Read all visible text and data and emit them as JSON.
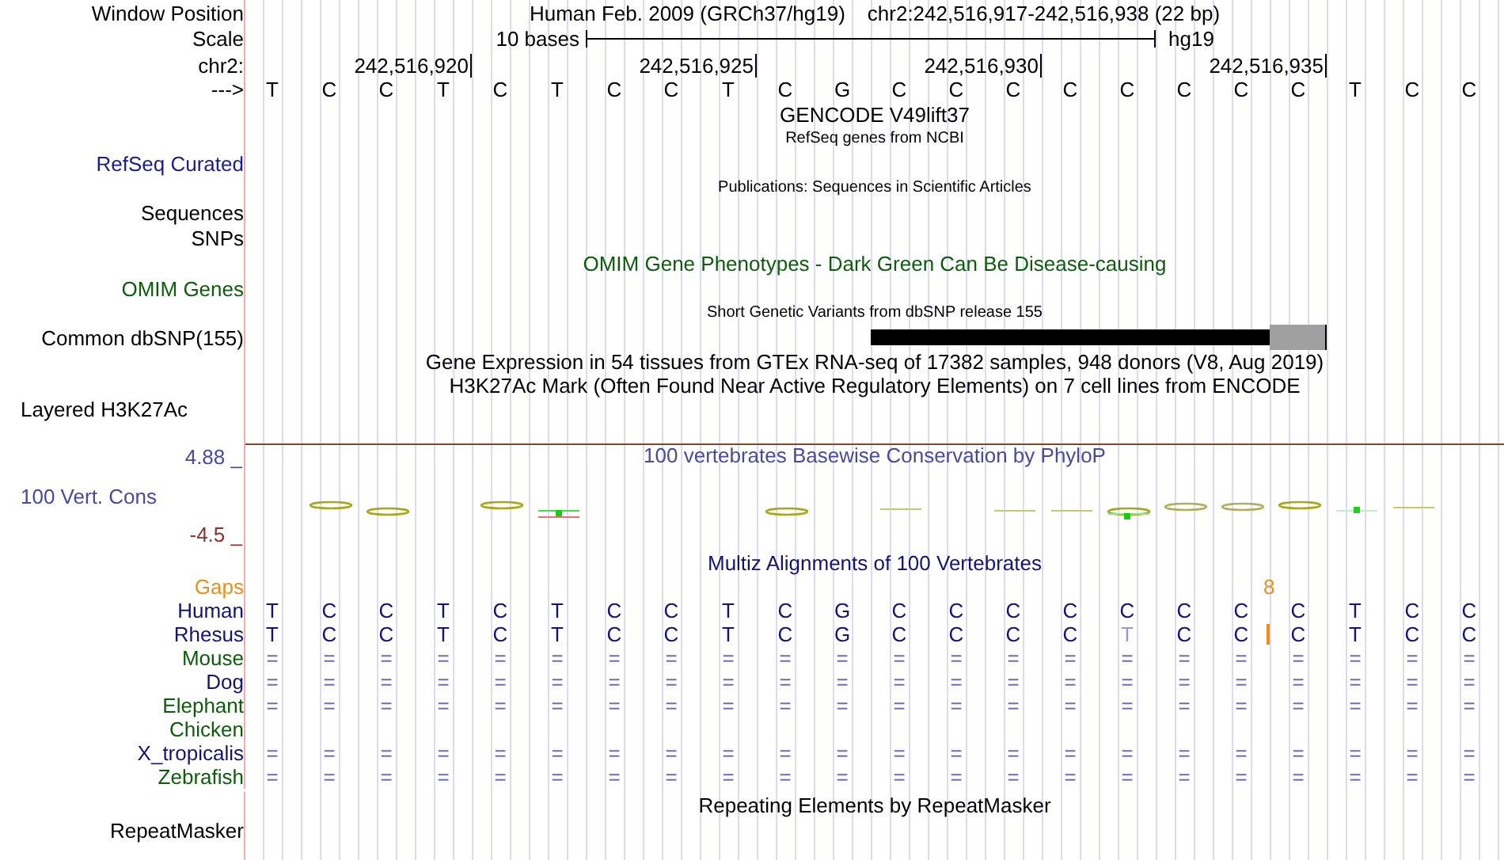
{
  "position": {
    "label": "Window Position",
    "assembly": "Human Feb. 2009 (GRCh37/hg19)",
    "range": "chr2:242,516,917-242,516,938 (22 bp)"
  },
  "scale": {
    "label": "Scale",
    "length": "10 bases",
    "assembly": "hg19"
  },
  "ruler": {
    "label": "chr2:",
    "ticks": [
      "242,516,920",
      "242,516,925",
      "242,516,930",
      "242,516,935"
    ]
  },
  "sequence": {
    "label": "--->",
    "bases": [
      "T",
      "C",
      "C",
      "T",
      "C",
      "T",
      "C",
      "C",
      "T",
      "C",
      "G",
      "C",
      "C",
      "C",
      "C",
      "C",
      "C",
      "C",
      "C",
      "T",
      "C",
      "C"
    ]
  },
  "tracks": [
    {
      "kind": "heading",
      "text": "GENCODE V49lift37",
      "color": "#000000"
    },
    {
      "kind": "caption",
      "text": "RefSeq genes from NCBI"
    },
    {
      "kind": "label",
      "label": "RefSeq Curated",
      "color": "#1c1c8a"
    },
    {
      "kind": "caption",
      "text": "Publications: Sequences in Scientific Articles"
    },
    {
      "kind": "label",
      "label": "Sequences",
      "color": "#000000"
    },
    {
      "kind": "label",
      "label": "SNPs",
      "color": "#000000"
    },
    {
      "kind": "heading",
      "text": "OMIM Gene Phenotypes - Dark Green Can Be Disease-causing",
      "color": "#0c5c0c"
    },
    {
      "kind": "label",
      "label": "OMIM Genes",
      "color": "#0c5c0c"
    },
    {
      "kind": "caption",
      "text": "Short Genetic Variants from dbSNP release 155"
    },
    {
      "kind": "snp",
      "label": "Common dbSNP(155)"
    },
    {
      "kind": "heading",
      "text": "Gene Expression in 54 tissues from GTEx RNA-seq of 17382 samples, 948 donors (V8, Aug 2019)",
      "color": "#000000"
    },
    {
      "kind": "heading",
      "text": "H3K27Ac Mark (Often Found Near Active Regulatory Elements) on 7 cell lines from ENCODE",
      "color": "#000000"
    },
    {
      "kind": "composite",
      "label": "Layered H3K27Ac"
    },
    {
      "kind": "wiggle",
      "label": "100 Vert. Cons",
      "max": "4.88 _",
      "min": "-4.5 _",
      "title": "100 vertebrates Basewise Conservation by PhyloP"
    },
    {
      "kind": "heading",
      "text": "Multiz Alignments of 100 Vertebrates",
      "color": "#14146e"
    },
    {
      "kind": "alignment",
      "gaps": {
        "label": "Gaps"
      },
      "species": [
        {
          "name": "Human",
          "color": "#14146e",
          "bases": [
            "T",
            "C",
            "C",
            "T",
            "C",
            "T",
            "C",
            "C",
            "T",
            "C",
            "G",
            "C",
            "C",
            "C",
            "C",
            "C",
            "C",
            "C",
            "C",
            "T",
            "C",
            "C"
          ]
        },
        {
          "name": "Rhesus",
          "color": "#14146e",
          "bases": [
            {
              "kind": "base",
              "base": "T",
              "faded": false
            },
            {
              "kind": "base",
              "base": "C",
              "faded": false
            },
            {
              "kind": "base",
              "base": "C",
              "faded": false
            },
            {
              "kind": "base",
              "base": "T",
              "faded": false
            },
            {
              "kind": "base",
              "base": "C",
              "faded": false
            },
            {
              "kind": "base",
              "base": "T",
              "faded": false
            },
            {
              "kind": "base",
              "base": "C",
              "faded": false
            },
            {
              "kind": "base",
              "base": "C",
              "faded": false
            },
            {
              "kind": "base",
              "base": "T",
              "faded": false
            },
            {
              "kind": "base",
              "base": "C",
              "faded": false
            },
            {
              "kind": "base",
              "base": "G",
              "faded": false
            },
            {
              "kind": "base",
              "base": "C",
              "faded": false
            },
            {
              "kind": "base",
              "base": "C",
              "faded": false
            },
            {
              "kind": "base",
              "base": "C",
              "faded": false
            },
            {
              "kind": "base",
              "base": "C",
              "faded": false
            },
            {
              "kind": "base",
              "base": "T",
              "faded": true
            },
            {
              "kind": "base",
              "base": "C",
              "faded": false
            },
            {
              "kind": "base",
              "base": "C",
              "faded": false
            },
            {
              "kind": "insertion",
              "count": "8"
            },
            {
              "kind": "base",
              "base": "C",
              "faded": false
            },
            {
              "kind": "base",
              "base": "T",
              "faded": false
            },
            {
              "kind": "base",
              "base": "C",
              "faded": false
            },
            {
              "kind": "base",
              "base": "C",
              "faded": false
            }
          ]
        },
        {
          "name": "Mouse",
          "color": "#0c5c0c",
          "bases": [
            "=",
            "=",
            "=",
            "=",
            "=",
            "=",
            "=",
            "=",
            "=",
            "=",
            "=",
            "=",
            "=",
            "=",
            "=",
            "=",
            "=",
            "=",
            "=",
            "=",
            "=",
            "="
          ]
        },
        {
          "name": "Dog",
          "color": "#14146e",
          "bases": [
            "=",
            "=",
            "=",
            "=",
            "=",
            "=",
            "=",
            "=",
            "=",
            "=",
            "=",
            "=",
            "=",
            "=",
            "=",
            "=",
            "=",
            "=",
            "=",
            "=",
            "=",
            "="
          ]
        },
        {
          "name": "Elephant",
          "color": "#0c5c0c",
          "bases": [
            "=",
            "=",
            "=",
            "=",
            "=",
            "=",
            "=",
            "=",
            "=",
            "=",
            "=",
            "=",
            "=",
            "=",
            "=",
            "=",
            "=",
            "=",
            "=",
            "=",
            "=",
            "="
          ]
        },
        {
          "name": "Chicken",
          "color": "#0c5c0c"
        },
        {
          "name": "X_tropicalis",
          "color": "#14146e",
          "bases": [
            "=",
            "=",
            "=",
            "=",
            "=",
            "=",
            "=",
            "=",
            "=",
            "=",
            "=",
            "=",
            "=",
            "=",
            "=",
            "=",
            "=",
            "=",
            "=",
            "=",
            "=",
            "="
          ]
        },
        {
          "name": "Zebrafish",
          "color": "#0c5c0c",
          "bases": [
            "=",
            "=",
            "=",
            "=",
            "=",
            "=",
            "=",
            "=",
            "=",
            "=",
            "=",
            "=",
            "=",
            "=",
            "=",
            "=",
            "=",
            "=",
            "=",
            "=",
            "=",
            "="
          ]
        }
      ]
    },
    {
      "kind": "heading",
      "text": "Repeating Elements by RepeatMasker",
      "color": "#000000"
    },
    {
      "kind": "label",
      "label": "RepeatMasker",
      "color": "#000000"
    }
  ]
}
